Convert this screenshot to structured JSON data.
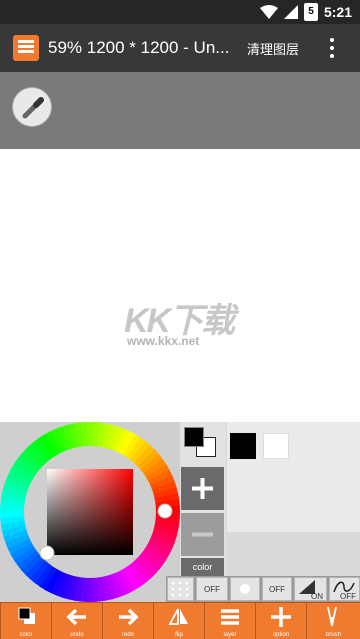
{
  "status_bar": {
    "time": "5:21",
    "battery": "5"
  },
  "app_bar": {
    "title": "59% 1200 * 1200 - Un...",
    "clear_layer": "清理图层"
  },
  "watermark": {
    "logo": "KK下载",
    "url": "www.kkx.net"
  },
  "colors": {
    "primary": "#000000",
    "secondary": "#ffffff",
    "accent": "#f07a2e",
    "accent_dark": "#b8561c",
    "selected_hue": "#ff0000"
  },
  "color_panel": {
    "color_button": "color",
    "swatches": [
      "#000000",
      "#ffffff"
    ]
  },
  "toggles": [
    {
      "name": "grid",
      "state": "OFF"
    },
    {
      "name": "dot",
      "state": "OFF"
    },
    {
      "name": "fill",
      "state": "ON"
    },
    {
      "name": "stabilizer",
      "state": "OFF"
    }
  ],
  "toolbar": [
    {
      "label": "color",
      "icon": "color-swatch-icon"
    },
    {
      "label": "undo",
      "icon": "arrow-left-icon"
    },
    {
      "label": "redo",
      "icon": "arrow-right-icon"
    },
    {
      "label": "flip",
      "icon": "flip-icon"
    },
    {
      "label": "layer",
      "icon": "layers-icon"
    },
    {
      "label": "option",
      "icon": "plus-icon"
    },
    {
      "label": "brush",
      "icon": "brush-icon"
    }
  ]
}
